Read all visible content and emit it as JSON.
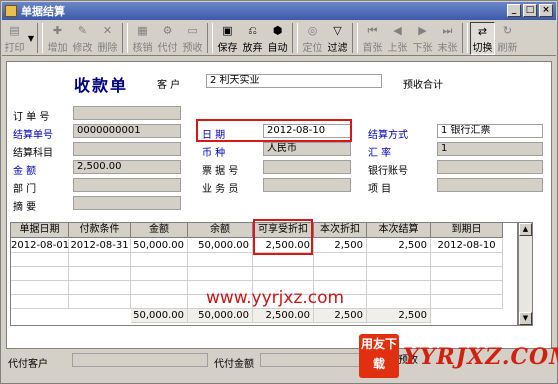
{
  "window": {
    "title": "单据结算"
  },
  "toolbar": {
    "buttons": [
      {
        "label": "打印",
        "icon": "printer-icon",
        "on": false
      },
      {
        "label": "增加",
        "icon": "add-doc-icon",
        "on": false
      },
      {
        "label": "修改",
        "icon": "edit-icon",
        "on": false
      },
      {
        "label": "删除",
        "icon": "delete-icon",
        "on": false
      },
      {
        "label": "核销",
        "icon": "verify-icon",
        "on": false
      },
      {
        "label": "代付",
        "icon": "proxy-pay-icon",
        "on": false
      },
      {
        "label": "预收",
        "icon": "prepay-icon",
        "on": false
      },
      {
        "label": "保存",
        "icon": "save-icon",
        "on": true
      },
      {
        "label": "放弃",
        "icon": "discard-icon",
        "on": true
      },
      {
        "label": "自动",
        "icon": "auto-icon",
        "on": true
      },
      {
        "label": "定位",
        "icon": "locate-icon",
        "on": false
      },
      {
        "label": "过滤",
        "icon": "filter-icon",
        "on": true
      },
      {
        "label": "首张",
        "icon": "first-icon",
        "on": false
      },
      {
        "label": "上张",
        "icon": "prev-icon",
        "on": false
      },
      {
        "label": "下张",
        "icon": "next-icon",
        "on": false
      },
      {
        "label": "末张",
        "icon": "last-icon",
        "on": false
      },
      {
        "label": "切换",
        "icon": "switch-icon",
        "on": true
      },
      {
        "label": "刷新",
        "icon": "refresh-icon",
        "on": false
      }
    ]
  },
  "form": {
    "title": "收款单",
    "customer_label": "客 户",
    "customer_value": "2  利天实业",
    "prepay_label": "预收合计",
    "order_no_label": "订 单 号",
    "order_no_value": "",
    "settle_no_label": "结算单号",
    "settle_no_value": "0000000001",
    "settle_subject_label": "结算科目",
    "settle_subject_value": "",
    "amount_label": "金 额",
    "amount_value": "2,500.00",
    "dept_label": "部 门",
    "dept_value": "",
    "summary_label": "摘 要",
    "summary_value": "",
    "date_label": "日 期",
    "date_value": "2012-08-10",
    "currency_label": "币 种",
    "currency_value": "人民币",
    "bill_no_label": "票 据 号",
    "bill_no_value": "",
    "staff_label": "业 务 员",
    "staff_value": "",
    "settle_method_label": "结算方式",
    "settle_method_value": "1  银行汇票",
    "rate_label": "汇 率",
    "rate_value": "1",
    "bank_acct_label": "银行账号",
    "bank_acct_value": "",
    "project_label": "项 目",
    "project_value": ""
  },
  "grid": {
    "headers": [
      "单据日期",
      "付款条件",
      "金额",
      "余额",
      "可享受折扣",
      "本次折扣",
      "本次结算",
      "到期日"
    ],
    "row": [
      "2012-08-01",
      "2012-08-31",
      "50,000.00",
      "50,000.00",
      "2,500.00",
      "2,500",
      "2,500",
      "2012-08-10"
    ],
    "totals": [
      "50,000.00",
      "50,000.00",
      "2,500.00",
      "2,500",
      "2,500"
    ]
  },
  "watermark": "www.yyrjxz.com",
  "bottom": {
    "proxy_customer_label": "代付客户",
    "proxy_amount_label": "代付金额",
    "use_prepay_label": "使用预收"
  },
  "logo": {
    "badge": "用友下载",
    "text": "YYRJXZ.COM"
  }
}
